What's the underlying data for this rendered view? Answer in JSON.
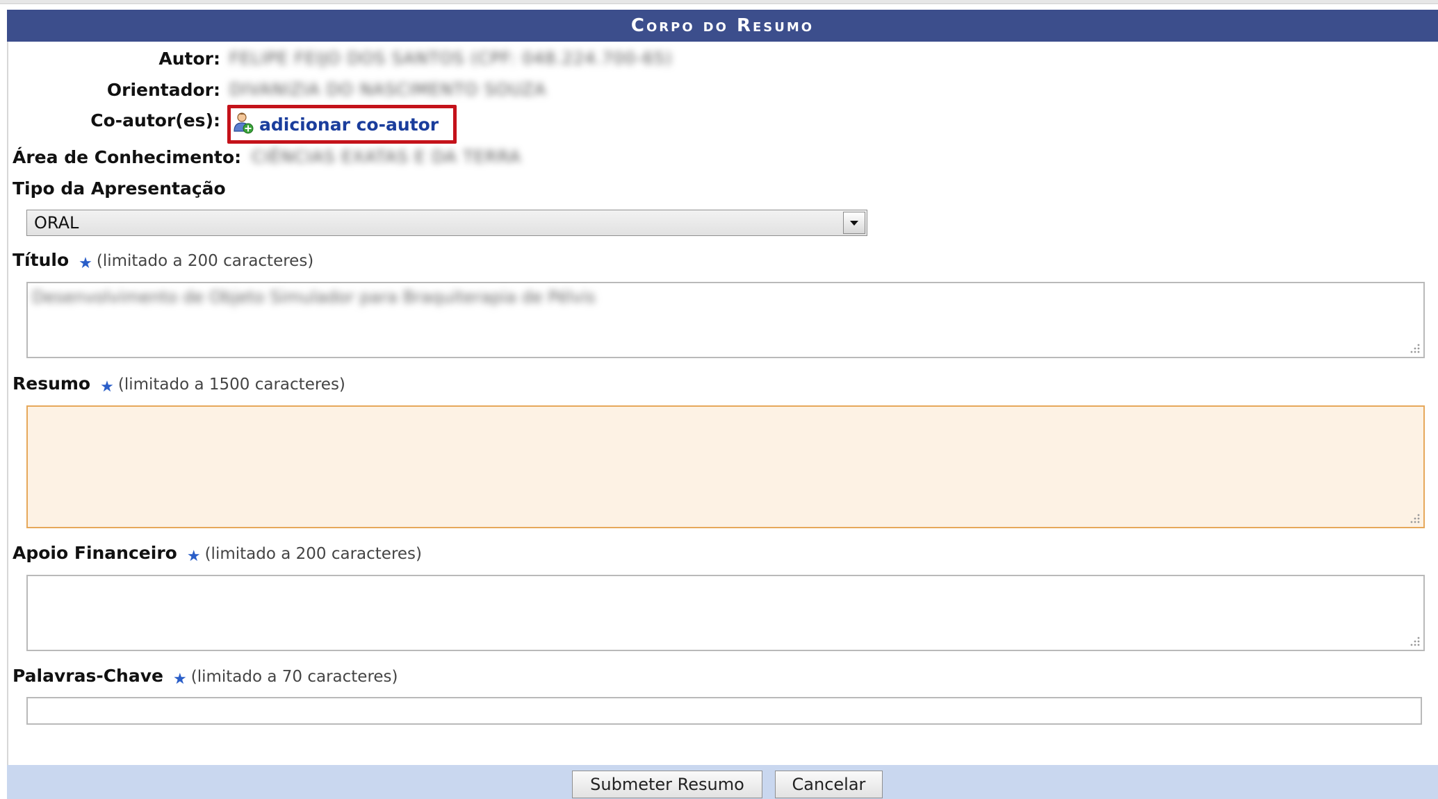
{
  "header": {
    "title": "Corpo do Resumo"
  },
  "fields": {
    "autor": {
      "label": "Autor:",
      "value": "FELIPE FEIJO DOS SANTOS (CPF: 048.224.700-65)"
    },
    "orientador": {
      "label": "Orientador:",
      "value": "DIVANIZIA DO NASCIMENTO SOUZA"
    },
    "coautores": {
      "label": "Co-autor(es):",
      "link": "adicionar co-autor"
    },
    "area": {
      "label": "Área de Conhecimento:",
      "value": "CIÊNCIAS EXATAS E DA TERRA"
    },
    "tipo": {
      "label": "Tipo da Apresentação",
      "selected": "ORAL"
    },
    "titulo": {
      "label": "Título",
      "hint": "(limitado a 200 caracteres)",
      "value": "Desenvolvimento de Objeto Simulador para Braquiterapia de Pélvis"
    },
    "resumo": {
      "label": "Resumo",
      "hint": "(limitado a 1500 caracteres)",
      "value": ""
    },
    "apoio": {
      "label": "Apoio Financeiro",
      "hint": "(limitado a 200 caracteres)",
      "value": ""
    },
    "palavras": {
      "label": "Palavras-Chave",
      "hint": "(limitado a 70 caracteres)",
      "value": ""
    }
  },
  "buttons": {
    "submit": "Submeter Resumo",
    "cancel": "Cancelar"
  },
  "icons": {
    "add_coauthor": "user-add-icon",
    "required": "star-icon",
    "dropdown": "chevron-down-icon",
    "resize": "resize-grip-icon"
  },
  "colors": {
    "header_bg": "#3c4e8c",
    "link": "#1a3d9c",
    "highlight_box": "#c4121a",
    "required_star": "#2a5ec8",
    "footer_bg": "#c9d7ef",
    "focused_field_bg": "#fdf2e4",
    "focused_field_border": "#e6a85a"
  }
}
